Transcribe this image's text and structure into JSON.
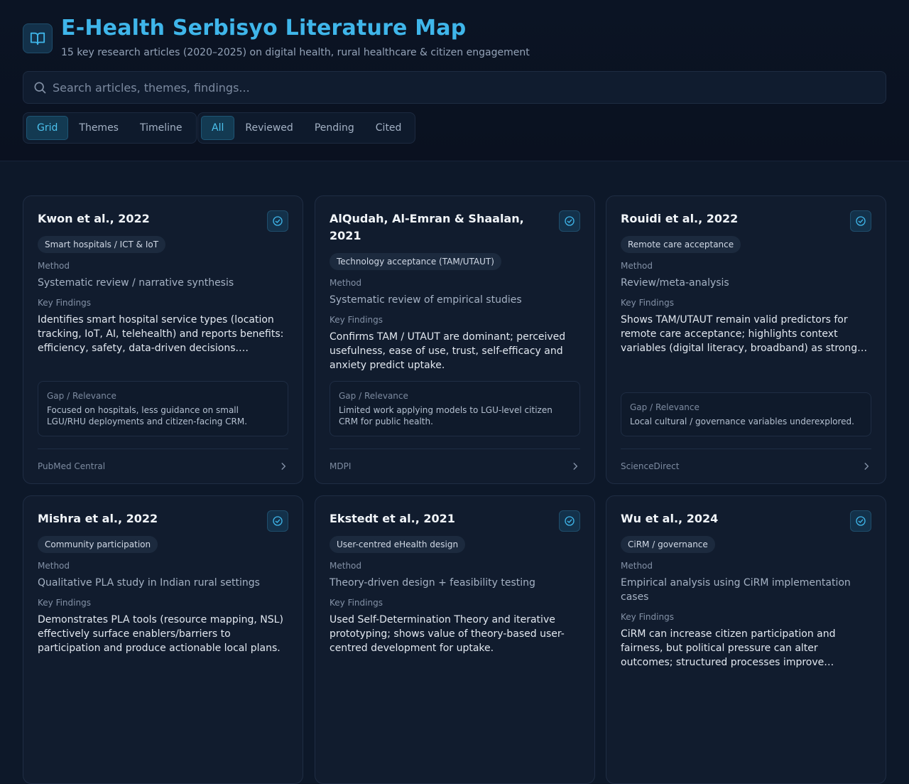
{
  "header": {
    "title": "E-Health Serbisyo Literature Map",
    "subtitle": "15 key research articles (2020–2025) on digital health, rural healthcare & citizen engagement",
    "logo_icon": "book-open-icon"
  },
  "search": {
    "placeholder": "Search articles, themes, findings..."
  },
  "view_tabs": [
    {
      "label": "Grid",
      "active": true
    },
    {
      "label": "Themes",
      "active": false
    },
    {
      "label": "Timeline",
      "active": false
    }
  ],
  "filter_tabs": [
    {
      "label": "All",
      "active": true
    },
    {
      "label": "Reviewed",
      "active": false
    },
    {
      "label": "Pending",
      "active": false
    },
    {
      "label": "Cited",
      "active": false
    }
  ],
  "labels": {
    "method": "Method",
    "findings": "Key Findings",
    "gap": "Gap / Relevance"
  },
  "colors": {
    "accent": "#3fb6ea",
    "background": "#0d1829",
    "card": "#111c2e"
  },
  "cards": [
    {
      "title": "Kwon et al., 2022",
      "tag": "Smart hospitals / ICT & IoT",
      "method": "Systematic review / narrative synthesis",
      "findings": "Identifies smart hospital service types (location tracking, IoT, AI, telehealth) and reports benefits: efficiency, safety, data-driven decisions.…",
      "gap": "Focused on hospitals, less guidance on small LGU/RHU deployments and citizen-facing CRM.",
      "source": "PubMed Central"
    },
    {
      "title": "AlQudah, Al-Emran & Shaalan, 2021",
      "tag": "Technology acceptance (TAM/UTAUT)",
      "method": "Systematic review of empirical studies",
      "findings": "Confirms TAM / UTAUT are dominant; perceived usefulness, ease of use, trust, self-efficacy and anxiety predict uptake.",
      "gap": "Limited work applying models to LGU-level citizen CRM for public health.",
      "source": "MDPI"
    },
    {
      "title": "Rouidi et al., 2022",
      "tag": "Remote care acceptance",
      "method": "Review/meta-analysis",
      "findings": "Shows TAM/UTAUT remain valid predictors for remote care acceptance; highlights context variables (digital literacy, broadband) as strong…",
      "gap": "Local cultural / governance variables underexplored.",
      "source": "ScienceDirect"
    },
    {
      "title": "Mishra et al., 2022",
      "tag": "Community participation",
      "method": "Qualitative PLA study in Indian rural settings",
      "findings": "Demonstrates PLA tools (resource mapping, NSL) effectively surface enablers/barriers to participation and produce actionable local plans.",
      "gap": "",
      "source": ""
    },
    {
      "title": "Ekstedt et al., 2021",
      "tag": "User-centred eHealth design",
      "method": "Theory-driven design + feasibility testing",
      "findings": "Used Self-Determination Theory and iterative prototyping; shows value of theory-based user-centred development for uptake.",
      "gap": "",
      "source": ""
    },
    {
      "title": "Wu et al., 2024",
      "tag": "CiRM / governance",
      "method": "Empirical analysis using CiRM implementation cases",
      "findings": "CiRM can increase citizen participation and fairness, but political pressure can alter outcomes; structured processes improve…",
      "gap": "",
      "source": ""
    }
  ]
}
